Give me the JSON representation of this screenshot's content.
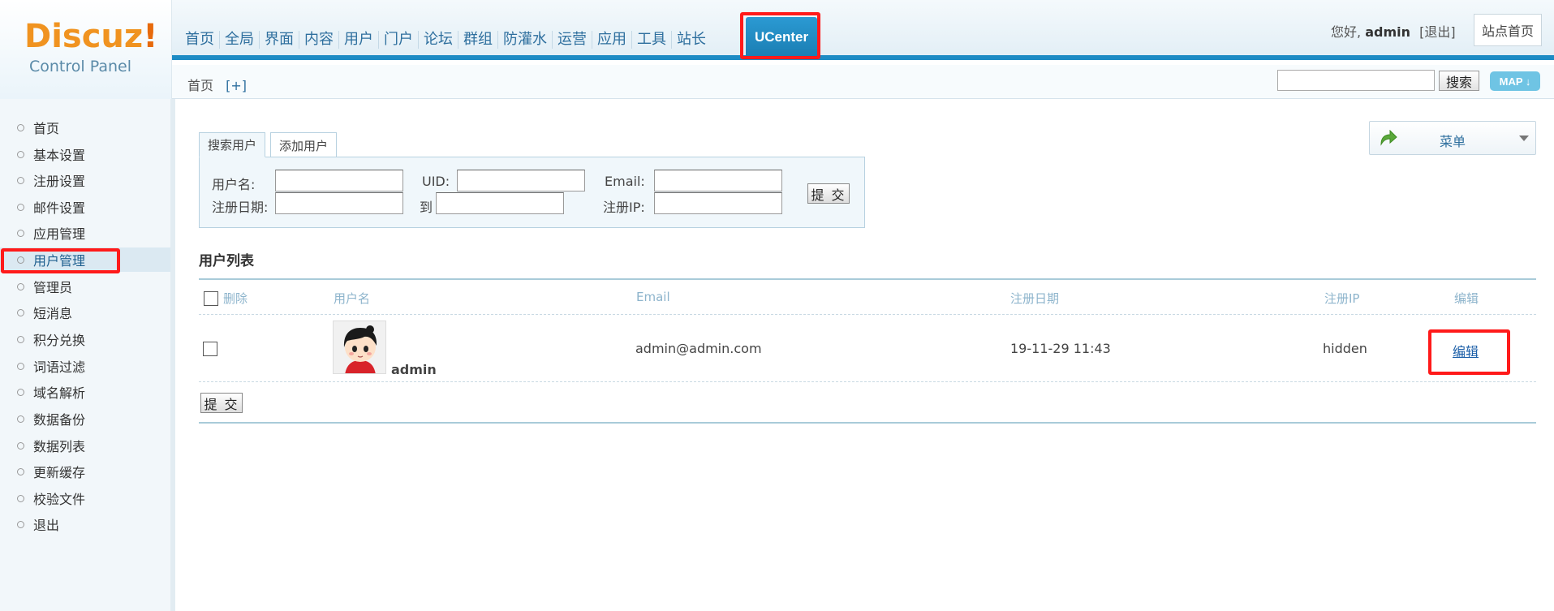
{
  "logo": {
    "brand": "Discuz",
    "brand_suffix": "!",
    "subtitle": "Control Panel"
  },
  "nav": {
    "items": [
      "首页",
      "全局",
      "界面",
      "内容",
      "用户",
      "门户",
      "论坛",
      "群组",
      "防灌水",
      "运营",
      "应用",
      "工具",
      "站长"
    ],
    "active": "UCenter"
  },
  "user": {
    "greeting": "您好,",
    "name": "admin",
    "logout": "[退出]",
    "site_home": "站点首页"
  },
  "breadcrumb": {
    "home": "首页",
    "add": "[+]"
  },
  "search": {
    "button": "搜索",
    "map": "MAP ↓"
  },
  "sidebar": {
    "items": [
      "首页",
      "基本设置",
      "注册设置",
      "邮件设置",
      "应用管理",
      "用户管理",
      "管理员",
      "短消息",
      "积分兑换",
      "词语过滤",
      "域名解析",
      "数据备份",
      "数据列表",
      "更新缓存",
      "校验文件",
      "退出"
    ],
    "active_index": 5
  },
  "menu_box": {
    "label": "菜单"
  },
  "tabs": [
    "搜索用户",
    "添加用户"
  ],
  "search_form": {
    "username_label": "用户名:",
    "uid_label": "UID:",
    "email_label": "Email:",
    "regdate_label": "注册日期:",
    "to_label": "到",
    "regip_label": "注册IP:",
    "submit": "提 交"
  },
  "user_list": {
    "title": "用户列表",
    "headers": {
      "delete": "删除",
      "username": "用户名",
      "email": "Email",
      "regdate": "注册日期",
      "regip": "注册IP",
      "edit": "编辑"
    },
    "rows": [
      {
        "username": "admin",
        "email": "admin@admin.com",
        "regdate": "19-11-29 11:43",
        "regip": "hidden",
        "edit": "编辑"
      }
    ],
    "submit": "提 交"
  },
  "highlight_color": "#ff1a1a",
  "accent_color": "#1c8bc4"
}
